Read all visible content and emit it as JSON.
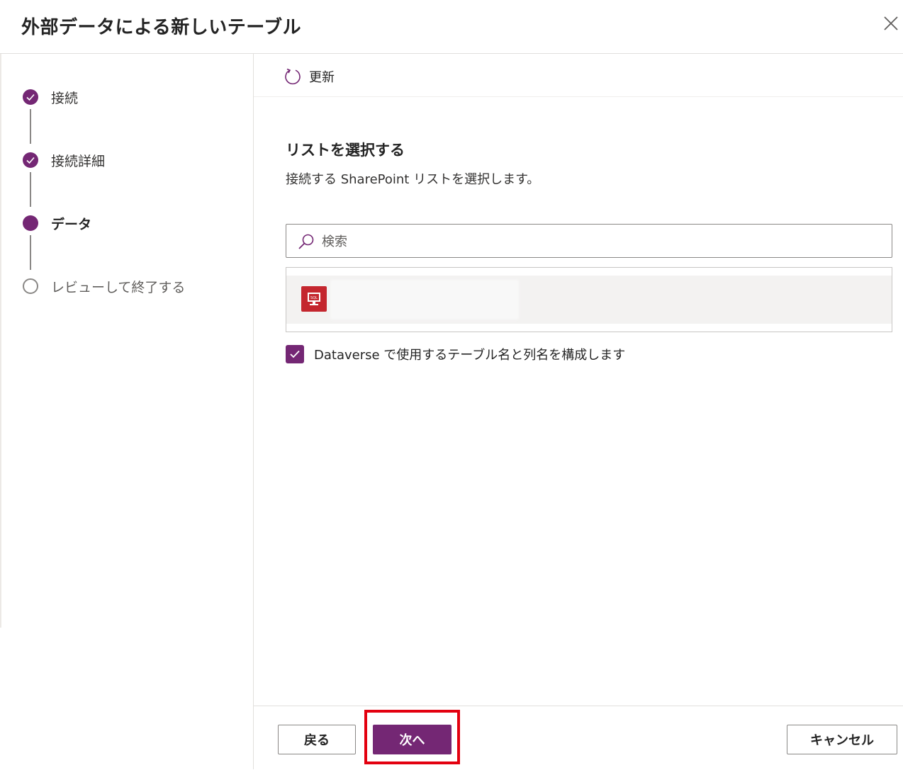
{
  "dialog": {
    "title": "外部データによる新しいテーブル",
    "close_icon": "close-icon"
  },
  "stepper": {
    "steps": [
      {
        "label": "接続",
        "status": "completed"
      },
      {
        "label": "接続詳細",
        "status": "completed"
      },
      {
        "label": "データ",
        "status": "current"
      },
      {
        "label": "レビューして終了する",
        "status": "upcoming"
      }
    ],
    "accent_color": "#742774"
  },
  "toolbar": {
    "refresh_label": "更新",
    "refresh_icon": "refresh-icon"
  },
  "main": {
    "section_title": "リストを選択する",
    "section_description": "接続する SharePoint リストを選択します。",
    "search": {
      "placeholder": "検索",
      "value": ""
    },
    "list_items": [
      {
        "icon": "sql-icon",
        "icon_text": "SQL",
        "name": "",
        "icon_color": "#c4262e"
      }
    ],
    "checkbox": {
      "label": "Dataverse で使用するテーブル名と列名を構成します",
      "checked": true
    }
  },
  "footer": {
    "back_label": "戻る",
    "next_label": "次へ",
    "cancel_label": "キャンセル"
  },
  "colors": {
    "primary": "#742774",
    "highlight": "#e3000f"
  }
}
